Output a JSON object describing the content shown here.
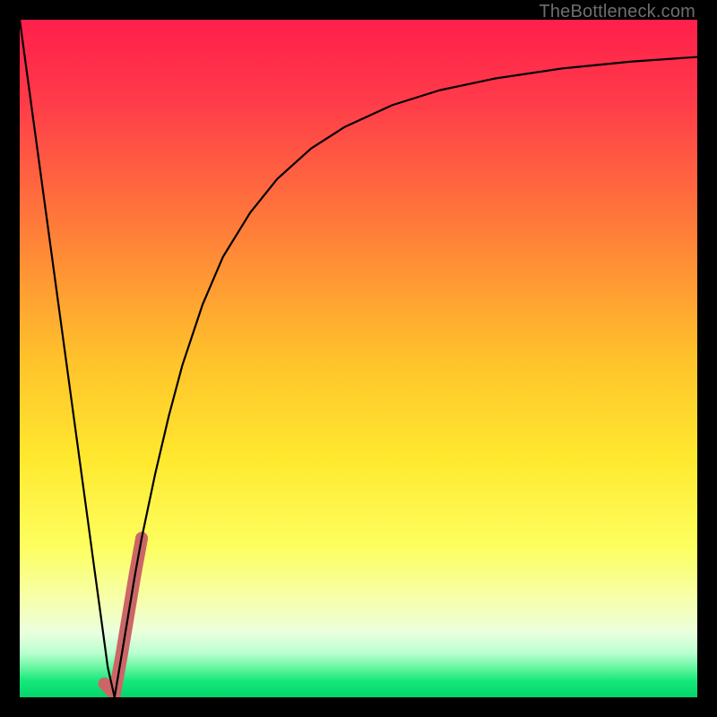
{
  "watermark": "TheBottleneck.com",
  "chart_data": {
    "type": "line",
    "title": "",
    "xlabel": "",
    "ylabel": "",
    "xlim": [
      0,
      100
    ],
    "ylim": [
      0,
      100
    ],
    "gradient_stops": [
      {
        "offset": 0.0,
        "color": "#ff1f4b"
      },
      {
        "offset": 0.12,
        "color": "#ff3b4a"
      },
      {
        "offset": 0.3,
        "color": "#ff7a3a"
      },
      {
        "offset": 0.5,
        "color": "#ffc22b"
      },
      {
        "offset": 0.65,
        "color": "#ffe92f"
      },
      {
        "offset": 0.78,
        "color": "#fdff60"
      },
      {
        "offset": 0.86,
        "color": "#f6ffb0"
      },
      {
        "offset": 0.905,
        "color": "#eaffde"
      },
      {
        "offset": 0.935,
        "color": "#b9ffcf"
      },
      {
        "offset": 0.955,
        "color": "#6cf7a3"
      },
      {
        "offset": 0.975,
        "color": "#18e87c"
      },
      {
        "offset": 1.0,
        "color": "#02d66a"
      }
    ],
    "series": [
      {
        "name": "bottleneck-curve",
        "color": "#000000",
        "stroke_width": 2.2,
        "x": [
          0.0,
          2.0,
          4.0,
          6.0,
          8.0,
          10.0,
          11.0,
          12.0,
          13.0,
          14.0,
          15.0,
          16.0,
          17.0,
          18.0,
          20.0,
          22.0,
          24.0,
          27.0,
          30.0,
          34.0,
          38.0,
          43.0,
          48.0,
          55.0,
          62.0,
          70.0,
          80.0,
          90.0,
          100.0
        ],
        "y": [
          100.0,
          85.3,
          70.6,
          55.9,
          41.2,
          26.5,
          19.1,
          11.8,
          4.4,
          0.0,
          6.0,
          12.0,
          18.0,
          23.5,
          33.0,
          41.5,
          49.0,
          58.0,
          65.0,
          71.5,
          76.5,
          81.0,
          84.2,
          87.4,
          89.6,
          91.3,
          92.8,
          93.8,
          94.5
        ]
      },
      {
        "name": "highlight-segment",
        "color": "#cc6666",
        "stroke_width": 14,
        "x": [
          12.5,
          13.5,
          14.0,
          15.0,
          16.0,
          17.0,
          18.0
        ],
        "y": [
          2.0,
          1.0,
          0.5,
          6.0,
          12.0,
          18.0,
          23.5
        ]
      }
    ]
  }
}
